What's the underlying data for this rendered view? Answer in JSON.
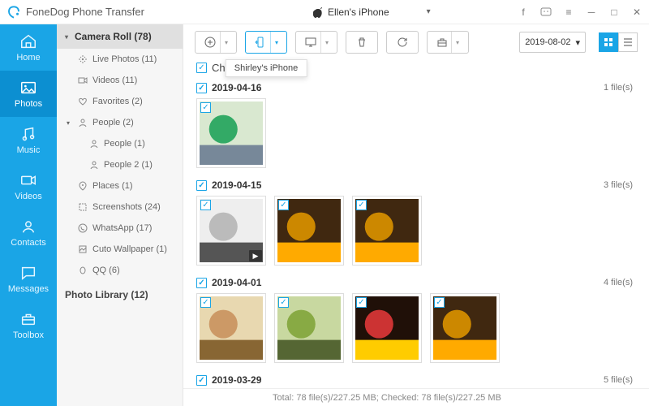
{
  "app_title": "FoneDog Phone Transfer",
  "device": {
    "name": "Ellen's iPhone"
  },
  "tooltip_target": "Shirley's iPhone",
  "rail": [
    {
      "label": "Home"
    },
    {
      "label": "Photos"
    },
    {
      "label": "Music"
    },
    {
      "label": "Videos"
    },
    {
      "label": "Contacts"
    },
    {
      "label": "Messages"
    },
    {
      "label": "Toolbox"
    }
  ],
  "sidebar": {
    "camera_roll": "Camera Roll (78)",
    "items": {
      "live": "Live Photos (11)",
      "videos": "Videos (11)",
      "fav": "Favorites (2)",
      "people": "People (2)",
      "people1": "People (1)",
      "people2": "People 2 (1)",
      "places": "Places (1)",
      "screens": "Screenshots (24)",
      "whatsapp": "WhatsApp (17)",
      "cuto": "Cuto Wallpaper (1)",
      "qq": "QQ (6)"
    },
    "library": "Photo Library (12)"
  },
  "check_all": "Check All(78)",
  "date_filter": "2019-08-02",
  "groups": [
    {
      "date": "2019-04-16",
      "count": "1 file(s)",
      "thumbs": 1
    },
    {
      "date": "2019-04-15",
      "count": "3 file(s)",
      "thumbs": 3,
      "video_on": 0
    },
    {
      "date": "2019-04-01",
      "count": "4 file(s)",
      "thumbs": 4
    },
    {
      "date": "2019-03-29",
      "count": "5 file(s)",
      "thumbs": 0
    }
  ],
  "status": "Total: 78 file(s)/227.25 MB; Checked: 78 file(s)/227.25 MB"
}
